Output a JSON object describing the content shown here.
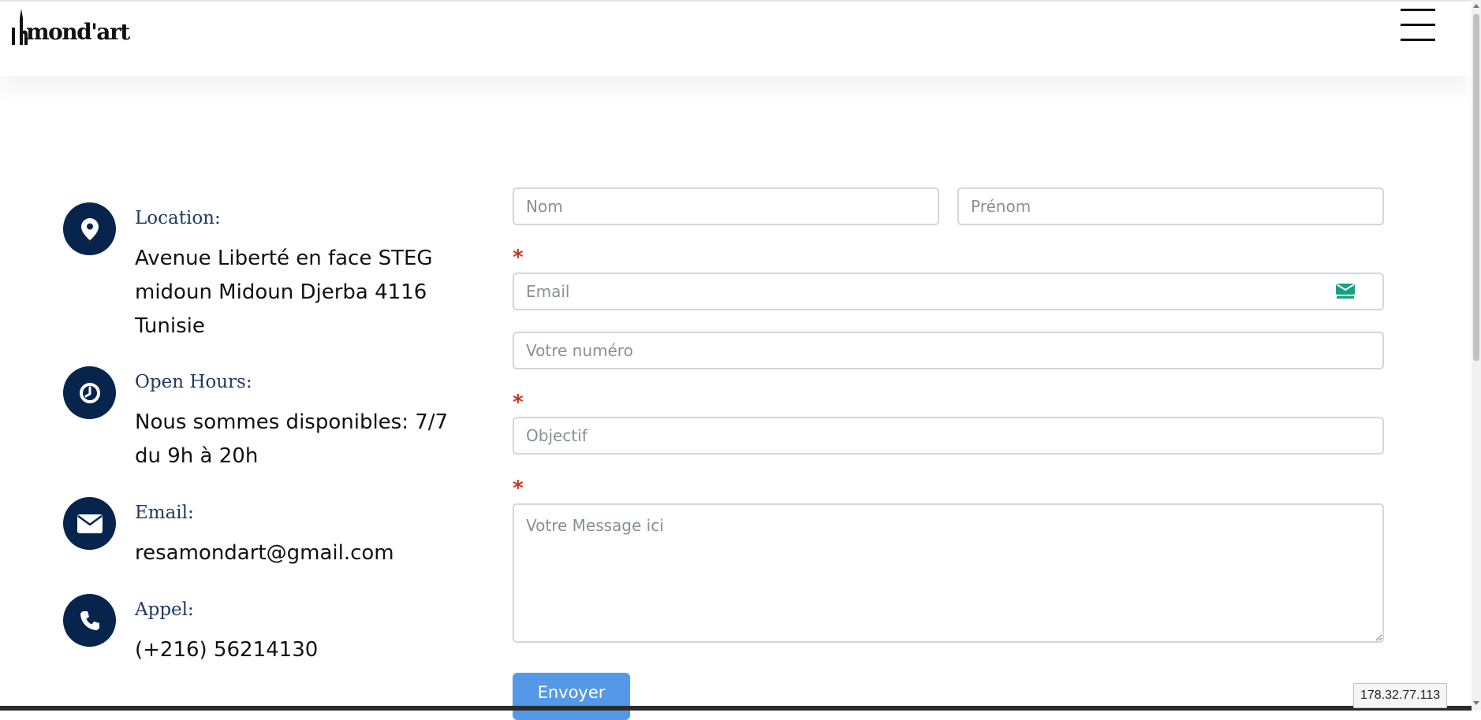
{
  "header": {
    "logo_text": "mond'art",
    "menu_icon": "hamburger-menu-icon"
  },
  "contact": {
    "location": {
      "icon": "map-pin-icon",
      "title": "Location:",
      "text": "Avenue Liberté en face STEG midoun Midoun Djerba 4116 Tunisie"
    },
    "hours": {
      "icon": "clock-icon",
      "title": "Open Hours:",
      "text": "Nous sommes disponibles: 7/7 du 9h à 20h"
    },
    "email": {
      "icon": "envelope-icon",
      "title": "Email:",
      "text": "resamondart@gmail.com"
    },
    "phone": {
      "icon": "phone-icon",
      "title": "Appel:",
      "text": "(+216) 56214130"
    }
  },
  "form": {
    "nom_placeholder": "Nom",
    "prenom_placeholder": "Prénom",
    "required_mark": "*",
    "email_placeholder": "Email",
    "numero_placeholder": "Votre numéro",
    "objectif_placeholder": "Objectif",
    "message_placeholder": "Votre Message ici",
    "submit_label": "Envoyer"
  },
  "ip_tooltip": "178.32.77.113",
  "colors": {
    "icon_circle": "#06244c",
    "title": "#1f3b63",
    "required": "#c0392b",
    "button": "#5499e8"
  }
}
